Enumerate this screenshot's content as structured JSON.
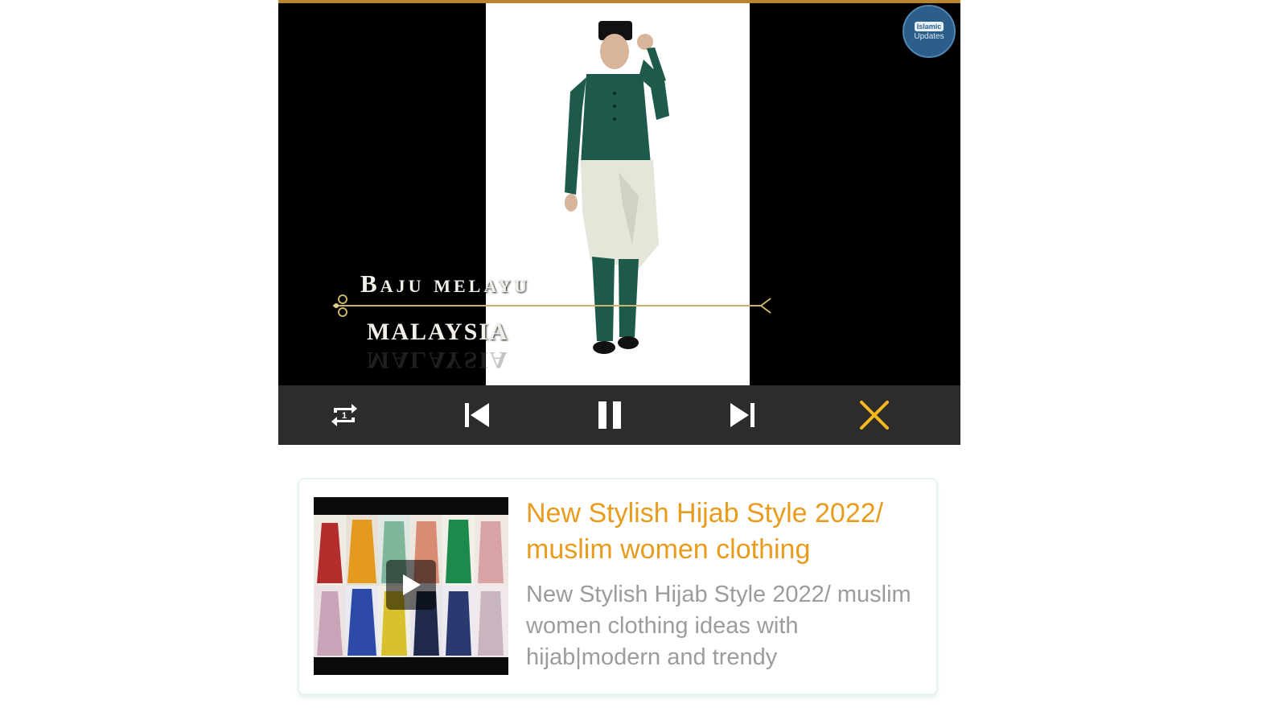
{
  "player": {
    "badge": {
      "top_label": "Islamic",
      "bottom_label": "Updates"
    },
    "overlay_title": {
      "line1": "Baju melayu",
      "line2": "MALAYSIA"
    },
    "controls": {
      "repeat_icon": "repeat-one-icon",
      "previous_icon": "skip-previous-icon",
      "pause_icon": "pause-icon",
      "next_icon": "skip-next-icon",
      "close_icon": "close-icon",
      "close_color": "#f5b61a"
    }
  },
  "card": {
    "title": "New Stylish Hijab Style 2022/ muslim women clothing",
    "description": "New Stylish Hijab Style 2022/ muslim women clothing ideas with hijab|modern and trendy",
    "title_color": "#e89b1c",
    "thumbnail_icon": "play-icon"
  }
}
